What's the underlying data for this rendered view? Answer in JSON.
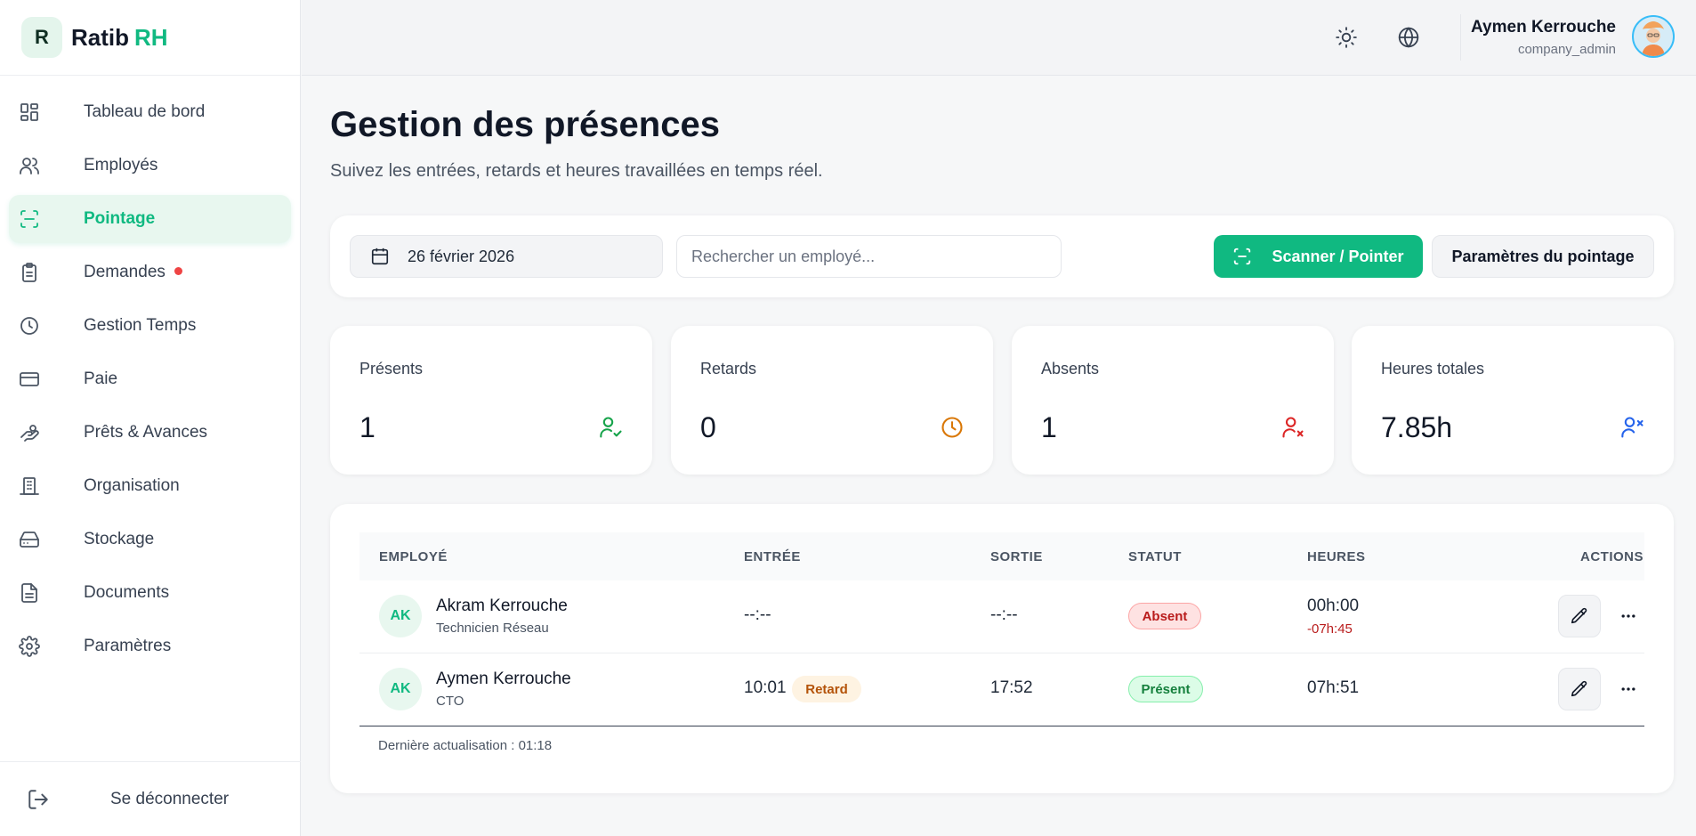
{
  "brand": {
    "logo_letter": "R",
    "name": "Ratib",
    "accent": "RH"
  },
  "sidebar": {
    "items": [
      {
        "label": "Tableau de bord",
        "icon": "dashboard-icon"
      },
      {
        "label": "Employés",
        "icon": "users-icon"
      },
      {
        "label": "Pointage",
        "icon": "scan-icon",
        "active": true
      },
      {
        "label": "Demandes",
        "icon": "clipboard-icon",
        "notification": true
      },
      {
        "label": "Gestion Temps",
        "icon": "clock-icon"
      },
      {
        "label": "Paie",
        "icon": "credit-card-icon"
      },
      {
        "label": "Prêts & Avances",
        "icon": "hand-coins-icon"
      },
      {
        "label": "Organisation",
        "icon": "building-icon"
      },
      {
        "label": "Stockage",
        "icon": "hard-drive-icon"
      },
      {
        "label": "Documents",
        "icon": "document-icon"
      },
      {
        "label": "Paramètres",
        "icon": "gear-icon"
      }
    ],
    "logout_label": "Se déconnecter"
  },
  "header": {
    "user_name": "Aymen Kerrouche",
    "user_role": "company_admin"
  },
  "page": {
    "title": "Gestion des présences",
    "subtitle": "Suivez les entrées, retards et heures travaillées en temps réel."
  },
  "toolbar": {
    "date": "26 février 2026",
    "search_placeholder": "Rechercher un employé...",
    "scan_label": "Scanner / Pointer",
    "params_label": "Paramètres du pointage"
  },
  "stats": [
    {
      "label": "Présents",
      "value": "1",
      "icon": "user-check-icon",
      "color": "#16a34a"
    },
    {
      "label": "Retards",
      "value": "0",
      "icon": "clock-icon",
      "color": "#d97706"
    },
    {
      "label": "Absents",
      "value": "1",
      "icon": "user-x-icon",
      "color": "#dc2626"
    },
    {
      "label": "Heures totales",
      "value": "7.85h",
      "icon": "users-icon",
      "color": "#2563eb"
    }
  ],
  "table": {
    "columns": [
      "EMPLOYÉ",
      "ENTRÉE",
      "SORTIE",
      "STATUT",
      "HEURES",
      "ACTIONS"
    ],
    "rows": [
      {
        "initials": "AK",
        "name": "Akram Kerrouche",
        "role": "Technicien Réseau",
        "in": "--:--",
        "out": "--:--",
        "status": "Absent",
        "hours": "00h:00",
        "diff": "-07h:45"
      },
      {
        "initials": "AK",
        "name": "Aymen Kerrouche",
        "role": "CTO",
        "in": "10:01",
        "late_badge": "Retard",
        "out": "17:52",
        "status": "Présent",
        "hours": "07h:51"
      }
    ],
    "footer": "Dernière actualisation : 01:18"
  },
  "colors": {
    "accent": "#10b981",
    "danger": "#ef4444"
  }
}
